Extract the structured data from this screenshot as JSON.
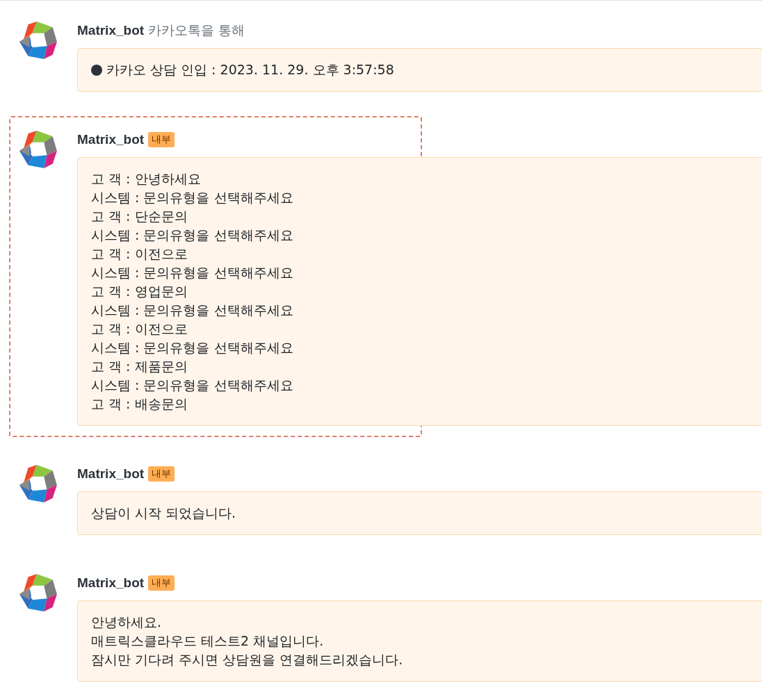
{
  "messages": [
    {
      "sender": "Matrix_bot",
      "via": "카카오톡을 통해",
      "kind": "event",
      "highlighted": false,
      "lines": [
        "카카오 상담 인입 : 2023. 11. 29. 오후 3:57:58"
      ]
    },
    {
      "sender": "Matrix_bot",
      "badge": "내부",
      "kind": "text",
      "highlighted": true,
      "lines": [
        "고 객 : 안녕하세요",
        "시스템 : 문의유형을 선택해주세요",
        "고 객 : 단순문의",
        "시스템 : 문의유형을 선택해주세요",
        "고 객 : 이전으로",
        "시스템 : 문의유형을 선택해주세요",
        "고 객 : 영업문의",
        "시스템 : 문의유형을 선택해주세요",
        "고 객 : 이전으로",
        "시스템 : 문의유형을 선택해주세요",
        "고 객 : 제품문의",
        "시스템 : 문의유형을 선택해주세요",
        "고 객 : 배송문의"
      ]
    },
    {
      "sender": "Matrix_bot",
      "badge": "내부",
      "kind": "text",
      "highlighted": false,
      "lines": [
        "상담이 시작 되었습니다."
      ]
    },
    {
      "sender": "Matrix_bot",
      "badge": "내부",
      "kind": "text",
      "highlighted": false,
      "lines": [
        "안녕하세요.",
        "매트릭스클라우드 테스트2 채널입니다.",
        "잠시만 기다려 주시면 상담원을 연결해드리겠습니다."
      ]
    }
  ]
}
